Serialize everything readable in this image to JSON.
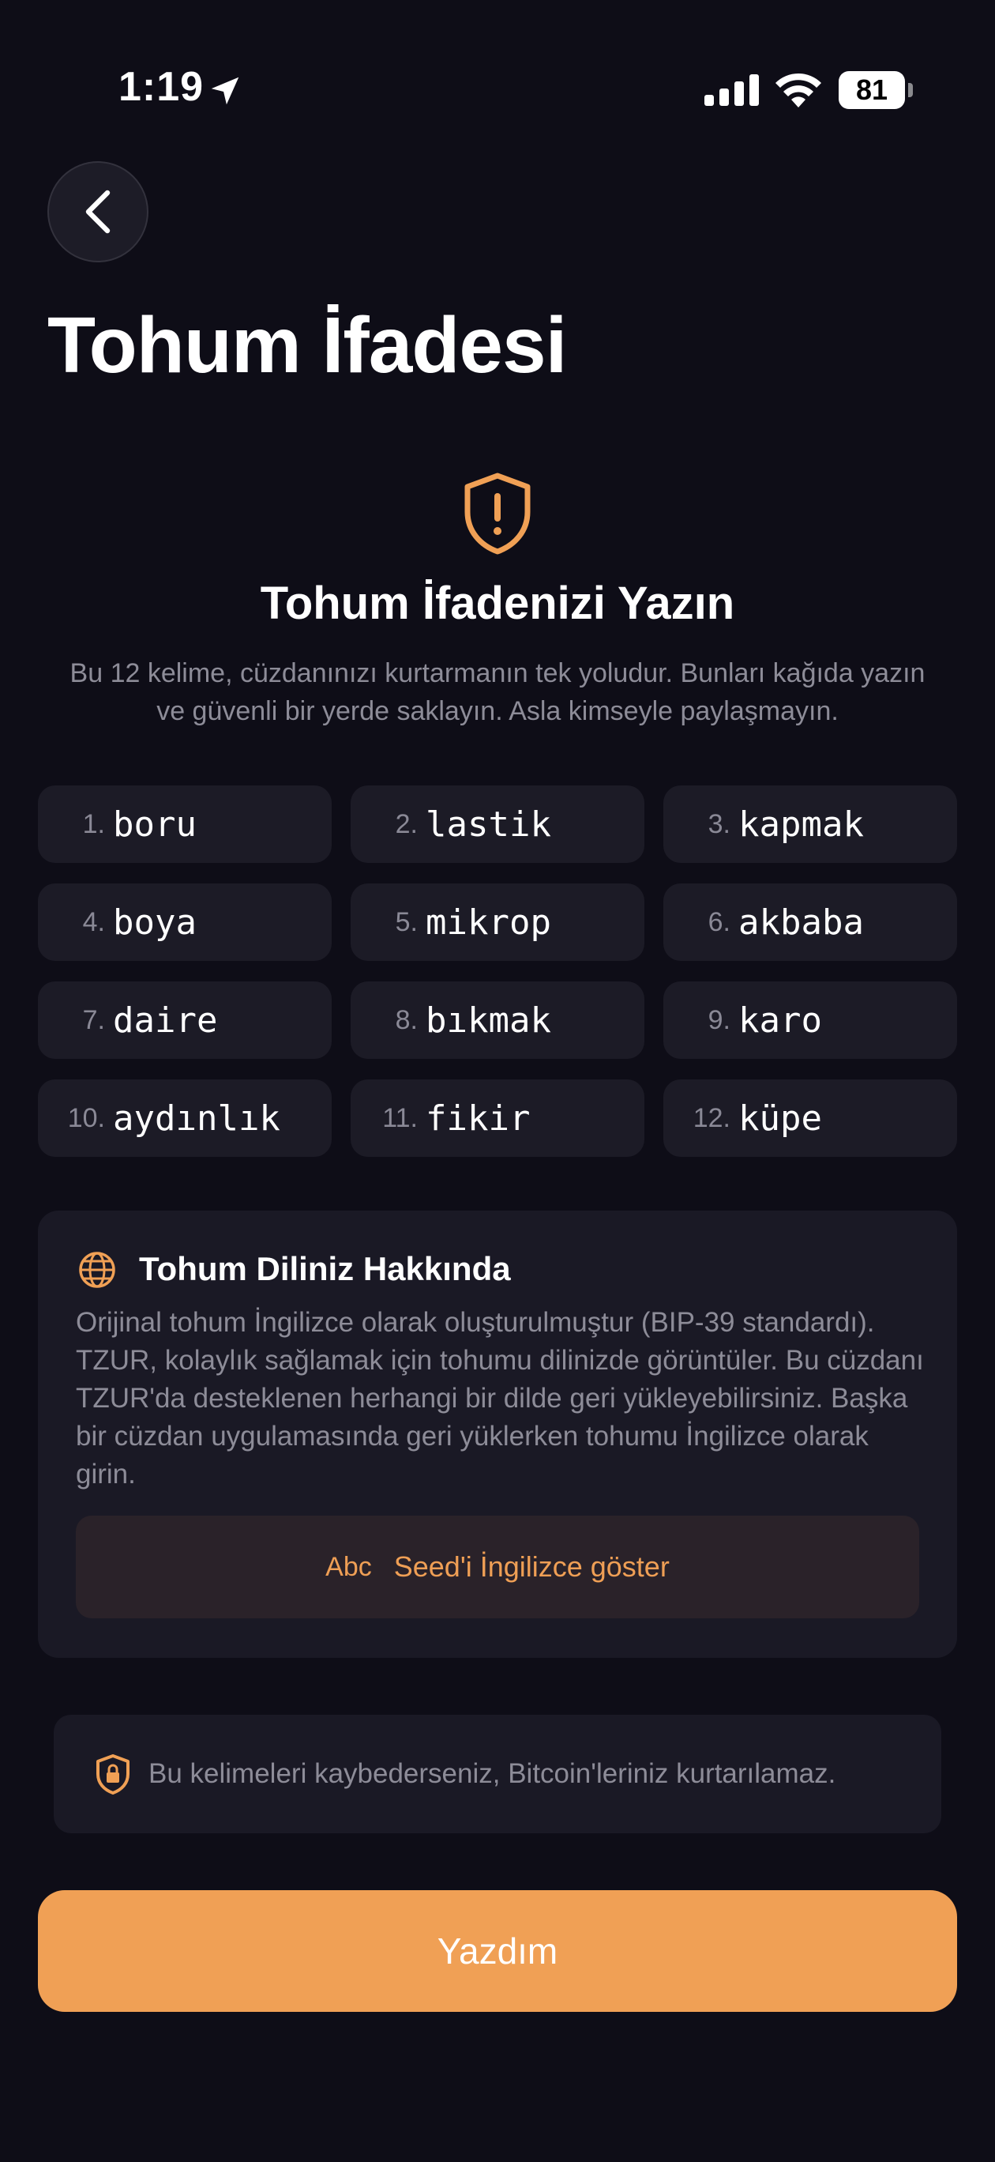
{
  "status_bar": {
    "time": "1:19",
    "battery": "81"
  },
  "header": {
    "title": "Tohum İfadesi"
  },
  "intro": {
    "title": "Tohum İfadenizi Yazın",
    "description": "Bu 12 kelime, cüzdanınızı kurtarmanın tek yoludur. Bunları kağıda yazın ve güvenli bir yerde saklayın. Asla kimseyle paylaşmayın."
  },
  "words": [
    {
      "num": "1.",
      "word": "boru"
    },
    {
      "num": "2.",
      "word": "lastik"
    },
    {
      "num": "3.",
      "word": "kapmak"
    },
    {
      "num": "4.",
      "word": "boya"
    },
    {
      "num": "5.",
      "word": "mikrop"
    },
    {
      "num": "6.",
      "word": "akbaba"
    },
    {
      "num": "7.",
      "word": "daire"
    },
    {
      "num": "8.",
      "word": "bıkmak"
    },
    {
      "num": "9.",
      "word": "karo"
    },
    {
      "num": "10.",
      "word": "aydınlık"
    },
    {
      "num": "11.",
      "word": "fikir"
    },
    {
      "num": "12.",
      "word": "küpe"
    }
  ],
  "info_card": {
    "title": "Tohum Diliniz Hakkında",
    "body": "Orijinal tohum İngilizce olarak oluşturulmuştur (BIP-39 standardı). TZUR, kolaylık sağlamak için tohumu dilinizde görüntüler. Bu cüzdanı TZUR'da desteklenen herhangi bir dilde geri yükleyebilirsiniz. Başka bir cüzdan uygulamasında geri yüklerken tohumu İngilizce olarak girin.",
    "button_icon": "Abc",
    "button_label": "Seed'i İngilizce göster"
  },
  "warning": {
    "text": "Bu kelimeleri kaybederseniz, Bitcoin'leriniz kurtarılamaz."
  },
  "primary_button": {
    "label": "Yazdım"
  },
  "colors": {
    "accent": "#f0a055",
    "background": "#0e0d17",
    "card": "#1c1b26"
  }
}
